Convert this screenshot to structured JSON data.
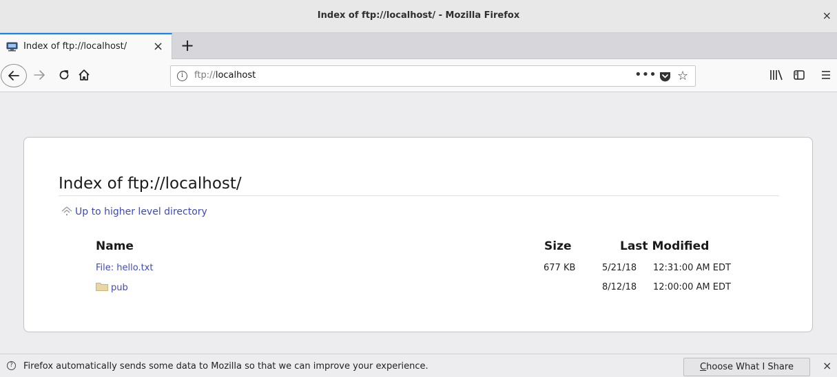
{
  "window": {
    "title": "Index of ftp://localhost/ - Mozilla Firefox",
    "close_glyph": "×"
  },
  "tab": {
    "label": "Index of ftp://localhost/",
    "close_glyph": "×"
  },
  "newtab_glyph": "+",
  "urlbar": {
    "scheme": "ftp://",
    "host": "localhost",
    "more_glyph": "•••",
    "star_glyph": "☆"
  },
  "icons": {
    "back": "back-arrow-icon",
    "forward": "forward-arrow-icon",
    "reload": "reload-icon",
    "home": "home-icon",
    "info": "info-icon",
    "pocket": "pocket-icon",
    "bookmark": "star-icon",
    "library": "library-icon",
    "sidebar": "sidebar-icon",
    "menu": "hamburger-menu-icon"
  },
  "listing": {
    "heading": "Index of ftp://localhost/",
    "up_link": "Up to higher level directory",
    "columns": {
      "name": "Name",
      "size": "Size",
      "modified": "Last Modified"
    },
    "rows": [
      {
        "name": "File: hello.txt",
        "size": "677 KB",
        "date": "5/21/18",
        "time": "12:31:00 AM EDT",
        "kind": "file"
      },
      {
        "name": "pub",
        "size": "",
        "date": "8/12/18",
        "time": "12:00:00 AM EDT",
        "kind": "folder"
      }
    ]
  },
  "notification": {
    "message": "Firefox automatically sends some data to Mozilla so that we can improve your experience.",
    "button_first": "C",
    "button_rest": "hoose What I Share",
    "close_glyph": "×"
  },
  "colors": {
    "accent": "#0a84ff",
    "link": "#3e4ab8",
    "folder": "#e8d6a4"
  }
}
